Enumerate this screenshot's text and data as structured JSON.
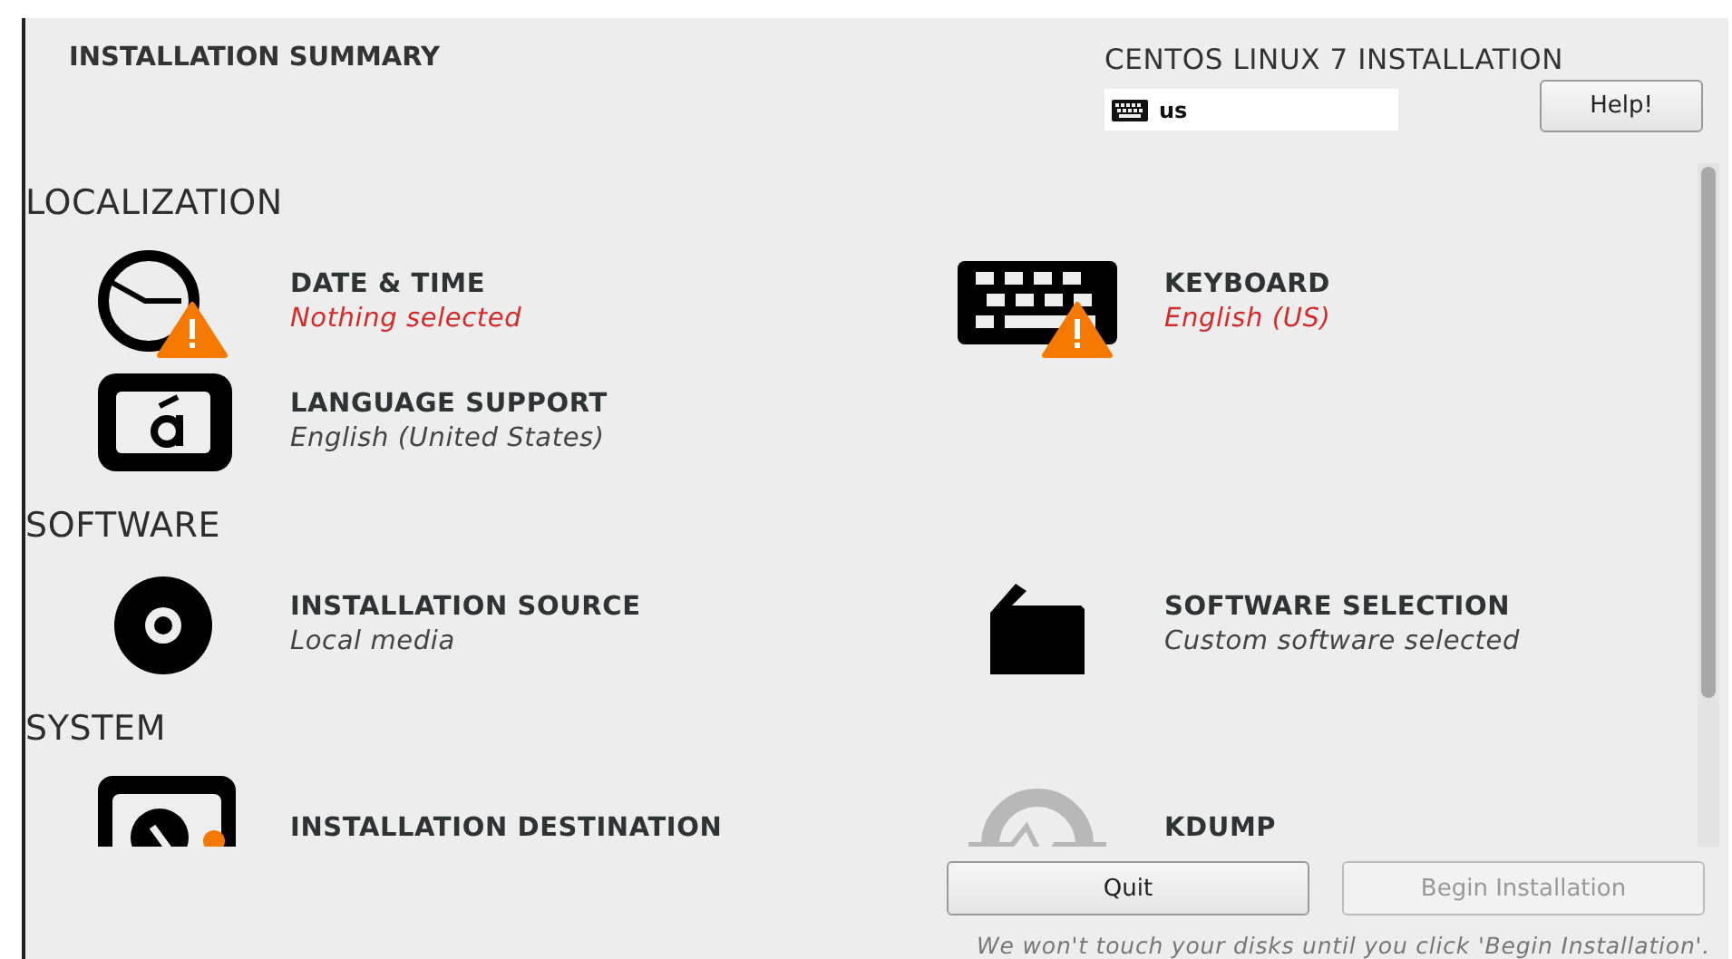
{
  "header": {
    "title": "INSTALLATION SUMMARY",
    "product": "CENTOS LINUX 7 INSTALLATION",
    "keyboard_layout": "us",
    "help_button": "Help!"
  },
  "sections": [
    {
      "title": "LOCALIZATION",
      "spokes": [
        {
          "kind": "clock",
          "title": "DATE & TIME",
          "status": "Nothing selected",
          "warning": true
        },
        {
          "kind": "keyboard",
          "title": "KEYBOARD",
          "status": "English (US)",
          "warning": true
        },
        {
          "kind": "language",
          "title": "LANGUAGE SUPPORT",
          "status": "English (United States)",
          "warning": false
        }
      ]
    },
    {
      "title": "SOFTWARE",
      "spokes": [
        {
          "kind": "disc",
          "title": "INSTALLATION SOURCE",
          "status": "Local media",
          "warning": false
        },
        {
          "kind": "package",
          "title": "SOFTWARE SELECTION",
          "status": "Custom software selected",
          "warning": false
        }
      ]
    },
    {
      "title": "SYSTEM",
      "spokes": [
        {
          "kind": "harddisk",
          "title": "INSTALLATION DESTINATION",
          "warning": true
        },
        {
          "kind": "kdump",
          "title": "KDUMP",
          "warning": false
        }
      ]
    }
  ],
  "buttons": [
    {
      "label": "Quit",
      "disabled": false
    },
    {
      "label": "Begin Installation",
      "disabled": true
    }
  ],
  "footer_note": "We won't touch your disks until you click 'Begin Installation'."
}
